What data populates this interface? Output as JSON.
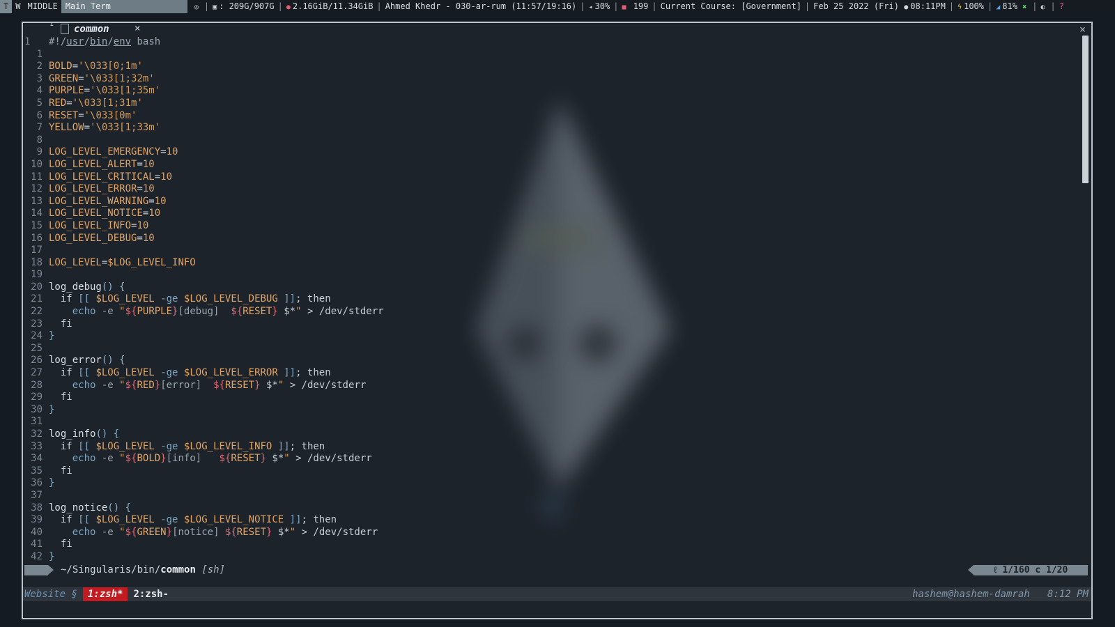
{
  "topbar": {
    "workspaces": [
      "T",
      "W",
      "MIDDLE"
    ],
    "window_title": "Main Term",
    "disk": "209G/907G",
    "memory": "2.16GiB/11.34GiB",
    "music": "Ahmed Khedr - 030-ar-rum (11:57/19:16)",
    "volume": "30%",
    "updates": "199",
    "course": "Current Course: [Government]",
    "date": "Feb 25 2022 (Fri)",
    "time": "08:11PM",
    "battery": "100%",
    "brightness": "81%",
    "help": "?"
  },
  "editor": {
    "tab_number": "1",
    "tab_name": "common",
    "tab_close": "×",
    "window_close": "×",
    "lines": [
      {
        "n": "1",
        "code": "#!/usr/bin/env bash"
      },
      {
        "n": "1",
        "code": ""
      },
      {
        "n": "2",
        "code": "BOLD='\\033[0;1m'"
      },
      {
        "n": "3",
        "code": "GREEN='\\033[1;32m'"
      },
      {
        "n": "4",
        "code": "PURPLE='\\033[1;35m'"
      },
      {
        "n": "5",
        "code": "RED='\\033[1;31m'"
      },
      {
        "n": "6",
        "code": "RESET='\\033[0m'"
      },
      {
        "n": "7",
        "code": "YELLOW='\\033[1;33m'"
      },
      {
        "n": "8",
        "code": ""
      },
      {
        "n": "9",
        "code": "LOG_LEVEL_EMERGENCY=10"
      },
      {
        "n": "10",
        "code": "LOG_LEVEL_ALERT=10"
      },
      {
        "n": "11",
        "code": "LOG_LEVEL_CRITICAL=10"
      },
      {
        "n": "12",
        "code": "LOG_LEVEL_ERROR=10"
      },
      {
        "n": "13",
        "code": "LOG_LEVEL_WARNING=10"
      },
      {
        "n": "14",
        "code": "LOG_LEVEL_NOTICE=10"
      },
      {
        "n": "15",
        "code": "LOG_LEVEL_INFO=10"
      },
      {
        "n": "16",
        "code": "LOG_LEVEL_DEBUG=10"
      },
      {
        "n": "17",
        "code": ""
      },
      {
        "n": "18",
        "code": "LOG_LEVEL=$LOG_LEVEL_INFO"
      },
      {
        "n": "19",
        "code": ""
      },
      {
        "n": "20",
        "code": "log_debug() {"
      },
      {
        "n": "21",
        "code": "  if [[ $LOG_LEVEL -ge $LOG_LEVEL_DEBUG ]]; then"
      },
      {
        "n": "22",
        "code": "    echo -e \"${PURPLE}[debug]  ${RESET} $*\" > /dev/stderr"
      },
      {
        "n": "23",
        "code": "  fi"
      },
      {
        "n": "24",
        "code": "}"
      },
      {
        "n": "25",
        "code": ""
      },
      {
        "n": "26",
        "code": "log_error() {"
      },
      {
        "n": "27",
        "code": "  if [[ $LOG_LEVEL -ge $LOG_LEVEL_ERROR ]]; then"
      },
      {
        "n": "28",
        "code": "    echo -e \"${RED}[error]  ${RESET} $*\" > /dev/stderr"
      },
      {
        "n": "29",
        "code": "  fi"
      },
      {
        "n": "30",
        "code": "}"
      },
      {
        "n": "31",
        "code": ""
      },
      {
        "n": "32",
        "code": "log_info() {"
      },
      {
        "n": "33",
        "code": "  if [[ $LOG_LEVEL -ge $LOG_LEVEL_INFO ]]; then"
      },
      {
        "n": "34",
        "code": "    echo -e \"${BOLD}[info]   ${RESET} $*\" > /dev/stderr"
      },
      {
        "n": "35",
        "code": "  fi"
      },
      {
        "n": "36",
        "code": "}"
      },
      {
        "n": "37",
        "code": ""
      },
      {
        "n": "38",
        "code": "log_notice() {"
      },
      {
        "n": "39",
        "code": "  if [[ $LOG_LEVEL -ge $LOG_LEVEL_NOTICE ]]; then"
      },
      {
        "n": "40",
        "code": "    echo -e \"${GREEN}[notice] ${RESET} $*\" > /dev/stderr"
      },
      {
        "n": "41",
        "code": "  fi"
      },
      {
        "n": "42",
        "code": "}"
      }
    ],
    "status": {
      "path_dir": "~/Singularis/bin/",
      "path_file": "common",
      "filetype": "[sh]",
      "position": "ℓ 1/160 c 1/20"
    }
  },
  "tmux": {
    "session": "Website §",
    "windows": [
      "1:zsh*",
      "2:zsh-"
    ],
    "host": "hashem@hashem-damrah",
    "clock": "8:12 PM"
  },
  "colors": {
    "active_window": "#c21b22",
    "session_text": "#6f91b0",
    "status_block": "#7a8790"
  }
}
